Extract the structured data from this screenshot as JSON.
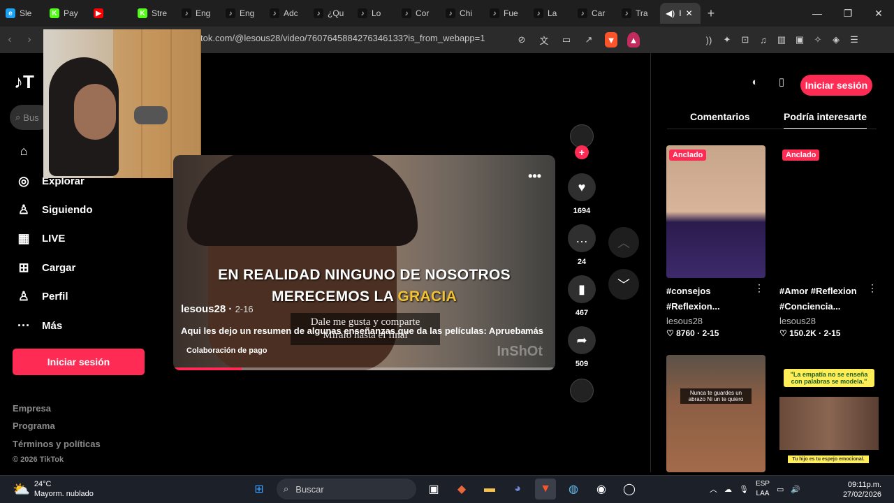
{
  "browser": {
    "tabs": [
      {
        "label": "Sle",
        "fav": "e",
        "color": "#1da1f2"
      },
      {
        "label": "Pay",
        "fav": "K",
        "color": "#53fc18"
      },
      {
        "label": "",
        "fav": "▶",
        "color": "#ff0000"
      },
      {
        "label": "Stre",
        "fav": "K",
        "color": "#53fc18"
      },
      {
        "label": "Eng",
        "fav": "♪",
        "color": "#111"
      },
      {
        "label": "Eng",
        "fav": "♪",
        "color": "#111"
      },
      {
        "label": "Adc",
        "fav": "♪",
        "color": "#111"
      },
      {
        "label": "¿Qu",
        "fav": "♪",
        "color": "#111"
      },
      {
        "label": "Lo",
        "fav": "♪",
        "color": "#111"
      },
      {
        "label": "Cor",
        "fav": "♪",
        "color": "#111"
      },
      {
        "label": "Chi",
        "fav": "♪",
        "color": "#111"
      },
      {
        "label": "Fue",
        "fav": "♪",
        "color": "#111"
      },
      {
        "label": "La",
        "fav": "♪",
        "color": "#111"
      },
      {
        "label": "Car",
        "fav": "♪",
        "color": "#111"
      },
      {
        "label": "Tra",
        "fav": "♪",
        "color": "#111"
      }
    ],
    "active_tab": "I",
    "url": "tok.com/@lesous28/video/7607645884276346133?is_from_webapp=1"
  },
  "sidebar": {
    "logo": "T",
    "search_placeholder": "Bus",
    "items": [
      {
        "label": "Explorar",
        "icon": "compass-icon"
      },
      {
        "label": "Siguiendo",
        "icon": "following-icon"
      },
      {
        "label": "LIVE",
        "icon": "live-icon"
      },
      {
        "label": "Cargar",
        "icon": "upload-icon"
      },
      {
        "label": "Perfil",
        "icon": "profile-icon"
      },
      {
        "label": "Más",
        "icon": "more-icon"
      }
    ],
    "login": "Iniciar sesión",
    "footer": [
      "Empresa",
      "Programa",
      "Términos y políticas"
    ],
    "copyright": "© 2026 TikTok"
  },
  "video": {
    "caption_line1": "EN REALIDAD NINGUNO DE NOSOTROS",
    "caption_line2_a": "MERECEMOS LA ",
    "caption_line2_b": "GRACIA",
    "username": "lesous28",
    "date": "2-16",
    "subtitle_1": "Dale me gusta y comparte",
    "subtitle_2": "Míralo hasta el final",
    "description": "Aqui les dejo un resumen de algunas enseñanzas que da las películas: Aprueba",
    "more": "más",
    "paid": "Colaboración de pago",
    "watermark": "InShOt",
    "progress": 0.18
  },
  "actions": {
    "likes": "1694",
    "comments": "24",
    "saves": "467",
    "shares": "509"
  },
  "right_panel": {
    "login": "Iniciar sesión",
    "tab_comments": "Comentarios",
    "tab_related": "Podría interesarte",
    "cards": [
      {
        "pin": "Anclado",
        "title": "#consejos #Reflexion...",
        "user": "lesous28",
        "stats": "♡ 8760 · 2-15"
      },
      {
        "pin": "Anclado",
        "title": "#Amor #Reflexion #Conciencia...",
        "user": "lesous28",
        "stats": "♡ 150.2K · 2-15"
      }
    ],
    "card3_caption": "Nunca te guardes un abrazo Ni un te quiero",
    "card4_caption": "\"La empatía no se enseña con palabras se modela.\"",
    "card4_footer": "Tu hijo es tu espejo emocional."
  },
  "taskbar": {
    "temp": "24°C",
    "weather": "Mayorm. nublado",
    "search": "Buscar",
    "lang1": "ESP",
    "lang2": "LAA",
    "time": "09:11p.m.",
    "date": "27/02/2026"
  }
}
